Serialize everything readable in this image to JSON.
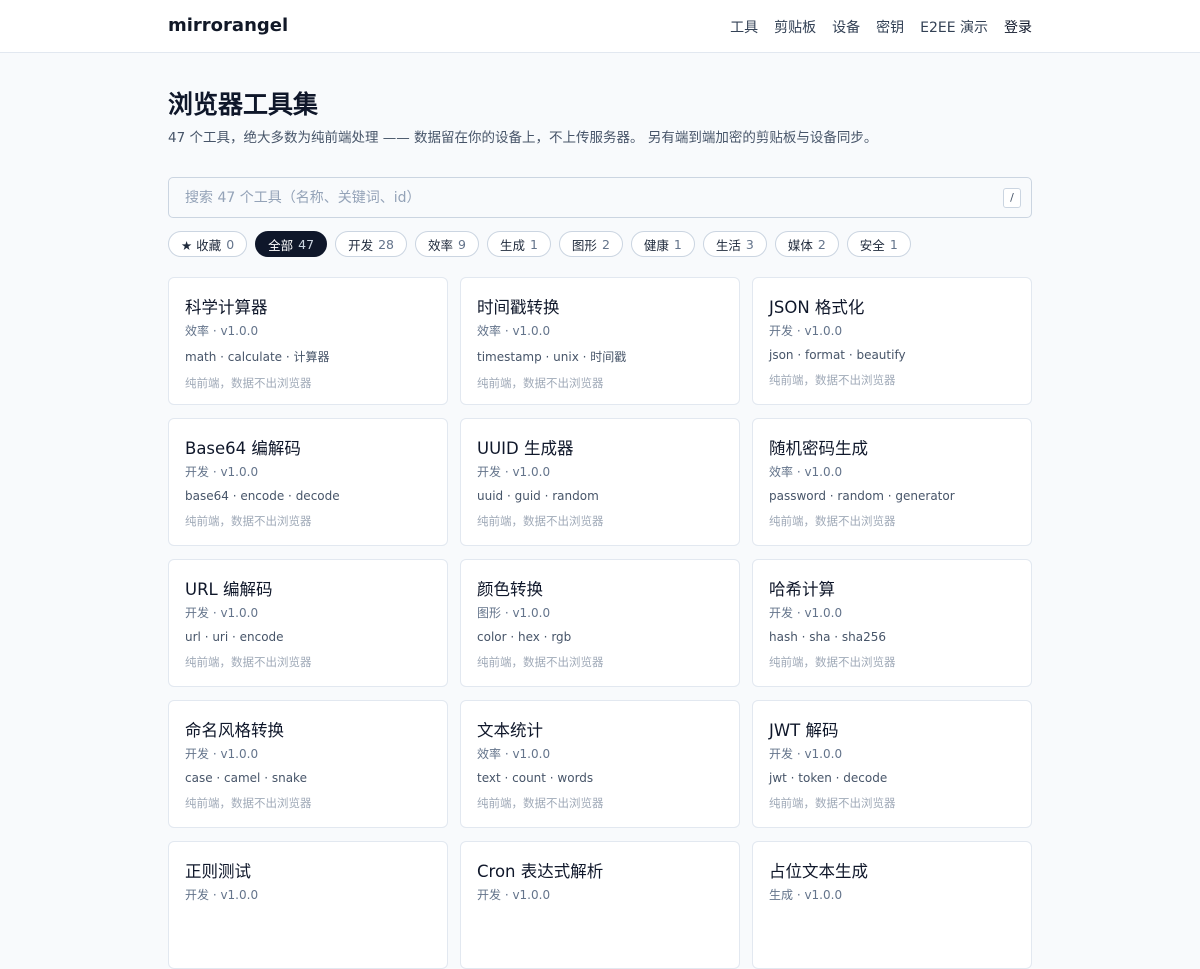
{
  "brand": "mirrorangel",
  "nav": [
    {
      "label": "工具"
    },
    {
      "label": "剪贴板"
    },
    {
      "label": "设备"
    },
    {
      "label": "密钥"
    },
    {
      "label": "E2EE 演示"
    },
    {
      "label": "登录"
    }
  ],
  "page": {
    "title": "浏览器工具集",
    "subtitle": "47 个工具，绝大多数为纯前端处理 —— 数据留在你的设备上，不上传服务器。 另有端到端加密的剪贴板与设备同步。"
  },
  "search": {
    "placeholder": "搜索 47 个工具（名称、关键词、id）",
    "shortcut": "/"
  },
  "filters": [
    {
      "label": "★ 收藏",
      "count": "0"
    },
    {
      "label": "全部",
      "count": "47",
      "active": true
    },
    {
      "label": "开发",
      "count": "28"
    },
    {
      "label": "效率",
      "count": "9"
    },
    {
      "label": "生成",
      "count": "1"
    },
    {
      "label": "图形",
      "count": "2"
    },
    {
      "label": "健康",
      "count": "1"
    },
    {
      "label": "生活",
      "count": "3"
    },
    {
      "label": "媒体",
      "count": "2"
    },
    {
      "label": "安全",
      "count": "1"
    }
  ],
  "tools": [
    {
      "title": "科学计算器",
      "meta": "效率 · v1.0.0",
      "keywords": "math · calculate · 计算器",
      "note": "纯前端，数据不出浏览器"
    },
    {
      "title": "时间戳转换",
      "meta": "效率 · v1.0.0",
      "keywords": "timestamp · unix · 时间戳",
      "note": "纯前端，数据不出浏览器"
    },
    {
      "title": "JSON 格式化",
      "meta": "开发 · v1.0.0",
      "keywords": "json · format · beautify",
      "note": "纯前端，数据不出浏览器"
    },
    {
      "title": "Base64 编解码",
      "meta": "开发 · v1.0.0",
      "keywords": "base64 · encode · decode",
      "note": "纯前端，数据不出浏览器"
    },
    {
      "title": "UUID 生成器",
      "meta": "开发 · v1.0.0",
      "keywords": "uuid · guid · random",
      "note": "纯前端，数据不出浏览器"
    },
    {
      "title": "随机密码生成",
      "meta": "效率 · v1.0.0",
      "keywords": "password · random · generator",
      "note": "纯前端，数据不出浏览器"
    },
    {
      "title": "URL 编解码",
      "meta": "开发 · v1.0.0",
      "keywords": "url · uri · encode",
      "note": "纯前端，数据不出浏览器"
    },
    {
      "title": "颜色转换",
      "meta": "图形 · v1.0.0",
      "keywords": "color · hex · rgb",
      "note": "纯前端，数据不出浏览器"
    },
    {
      "title": "哈希计算",
      "meta": "开发 · v1.0.0",
      "keywords": "hash · sha · sha256",
      "note": "纯前端，数据不出浏览器"
    },
    {
      "title": "命名风格转换",
      "meta": "开发 · v1.0.0",
      "keywords": "case · camel · snake",
      "note": "纯前端，数据不出浏览器"
    },
    {
      "title": "文本统计",
      "meta": "效率 · v1.0.0",
      "keywords": "text · count · words",
      "note": "纯前端，数据不出浏览器"
    },
    {
      "title": "JWT 解码",
      "meta": "开发 · v1.0.0",
      "keywords": "jwt · token · decode",
      "note": "纯前端，数据不出浏览器"
    },
    {
      "title": "正则测试",
      "meta": "开发 · v1.0.0",
      "keywords": "",
      "note": ""
    },
    {
      "title": "Cron 表达式解析",
      "meta": "开发 · v1.0.0",
      "keywords": "",
      "note": ""
    },
    {
      "title": "占位文本生成",
      "meta": "生成 · v1.0.0",
      "keywords": "",
      "note": ""
    }
  ]
}
